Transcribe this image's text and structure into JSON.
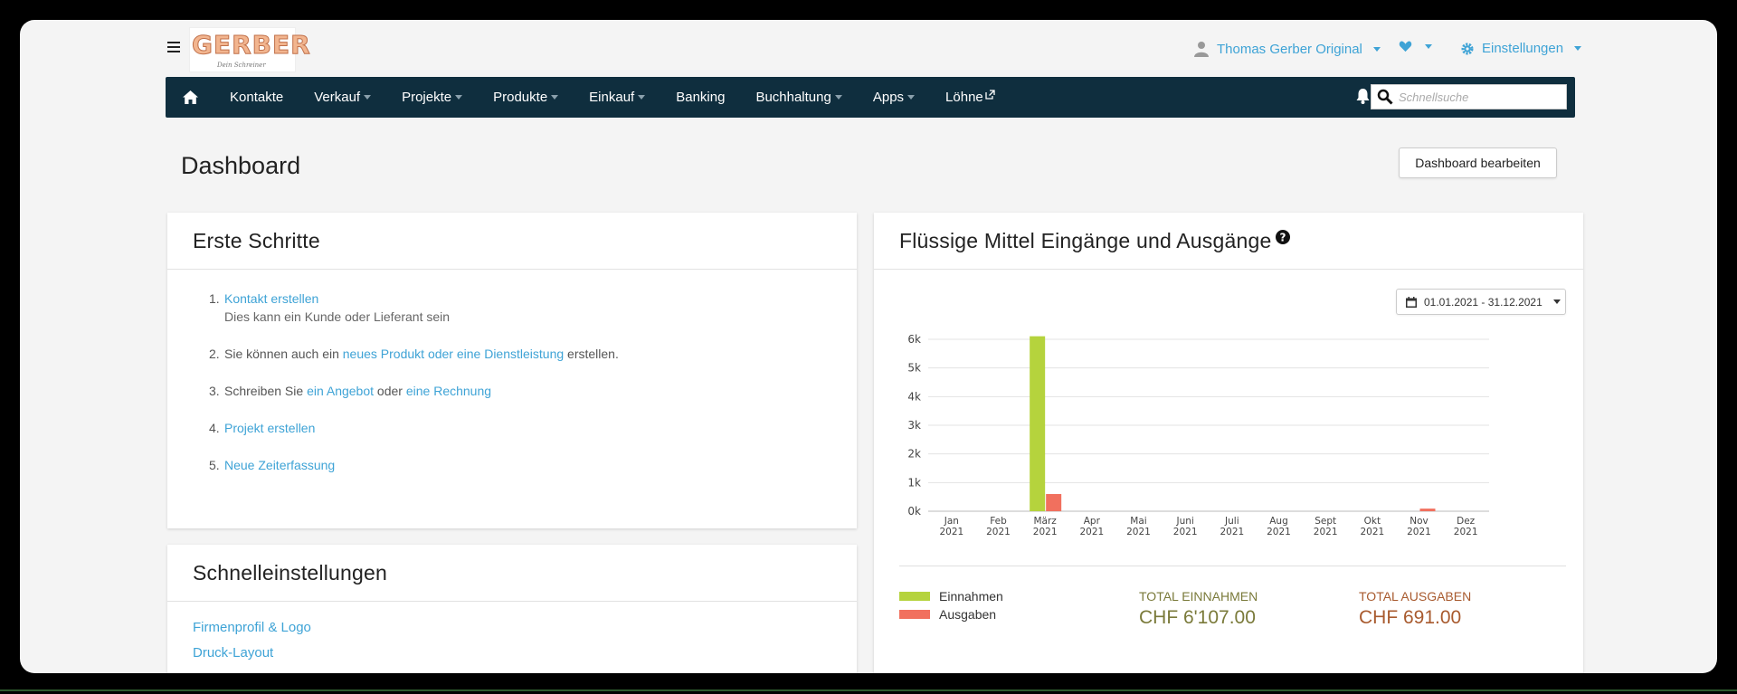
{
  "header": {
    "logo_text": "GERBER",
    "logo_subtext": "Dein Schreiner",
    "user_name": "Thomas Gerber Original",
    "settings_label": "Einstellungen"
  },
  "nav": {
    "items": [
      {
        "label": "Kontakte",
        "dropdown": false
      },
      {
        "label": "Verkauf",
        "dropdown": true
      },
      {
        "label": "Projekte",
        "dropdown": true
      },
      {
        "label": "Produkte",
        "dropdown": true
      },
      {
        "label": "Einkauf",
        "dropdown": true
      },
      {
        "label": "Banking",
        "dropdown": false
      },
      {
        "label": "Buchhaltung",
        "dropdown": true
      },
      {
        "label": "Apps",
        "dropdown": true
      },
      {
        "label": "Löhne",
        "dropdown": false,
        "external": true
      }
    ],
    "search_placeholder": "Schnellsuche"
  },
  "page": {
    "title": "Dashboard",
    "edit_button": "Dashboard bearbeiten"
  },
  "first_steps": {
    "title": "Erste Schritte",
    "items": [
      {
        "num": "1.",
        "parts": [
          {
            "text": "Kontakt erstellen",
            "link": true
          }
        ],
        "sub": "Dies kann ein Kunde oder Lieferant sein"
      },
      {
        "num": "2.",
        "parts": [
          {
            "text": "Sie können auch ein ",
            "link": false
          },
          {
            "text": "neues Produkt oder eine Dienstleistung",
            "link": true
          },
          {
            "text": " erstellen.",
            "link": false
          }
        ]
      },
      {
        "num": "3.",
        "parts": [
          {
            "text": "Schreiben Sie ",
            "link": false
          },
          {
            "text": "ein Angebot",
            "link": true
          },
          {
            "text": " oder ",
            "link": false
          },
          {
            "text": "eine Rechnung",
            "link": true
          }
        ]
      },
      {
        "num": "4.",
        "parts": [
          {
            "text": "Projekt erstellen",
            "link": true
          }
        ]
      },
      {
        "num": "5.",
        "parts": [
          {
            "text": "Neue Zeiterfassung",
            "link": true
          }
        ]
      }
    ]
  },
  "quick_settings": {
    "title": "Schnelleinstellungen",
    "links": [
      "Firmenprofil & Logo",
      "Druck-Layout"
    ]
  },
  "cashflow": {
    "title": "Flüssige Mittel Eingänge und Ausgänge",
    "date_range": "01.01.2021 - 31.12.2021",
    "legend_income": "Einnahmen",
    "legend_expenses": "Ausgaben",
    "total_income_label": "TOTAL EINNAHMEN",
    "total_income_value": "CHF 6'107.00",
    "total_expenses_label": "TOTAL AUSGABEN",
    "total_expenses_value": "CHF 691.00"
  },
  "colors": {
    "accent": "#3ea3d6",
    "navbar": "#0f2e3e",
    "income": "#b5d33d",
    "expenses": "#f1705e",
    "total_income_text": "#7a7a3a",
    "total_expenses_text": "#a85a2e"
  },
  "chart_data": {
    "type": "bar",
    "categories": [
      "Jan\n2021",
      "Feb\n2021",
      "März\n2021",
      "Apr\n2021",
      "Mai\n2021",
      "Juni\n2021",
      "Juli\n2021",
      "Aug\n2021",
      "Sept\n2021",
      "Okt\n2021",
      "Nov\n2021",
      "Dez\n2021"
    ],
    "series": [
      {
        "name": "Einnahmen",
        "values": [
          0,
          0,
          6107,
          0,
          0,
          0,
          0,
          0,
          0,
          0,
          0,
          0
        ]
      },
      {
        "name": "Ausgaben",
        "values": [
          0,
          0,
          600,
          0,
          0,
          0,
          0,
          0,
          0,
          0,
          91,
          0
        ]
      }
    ],
    "yticks": [
      "0k",
      "1k",
      "2k",
      "3k",
      "4k",
      "5k",
      "6k"
    ],
    "ylim": [
      0,
      6000
    ],
    "grid": true,
    "legend": "bottom-left"
  }
}
